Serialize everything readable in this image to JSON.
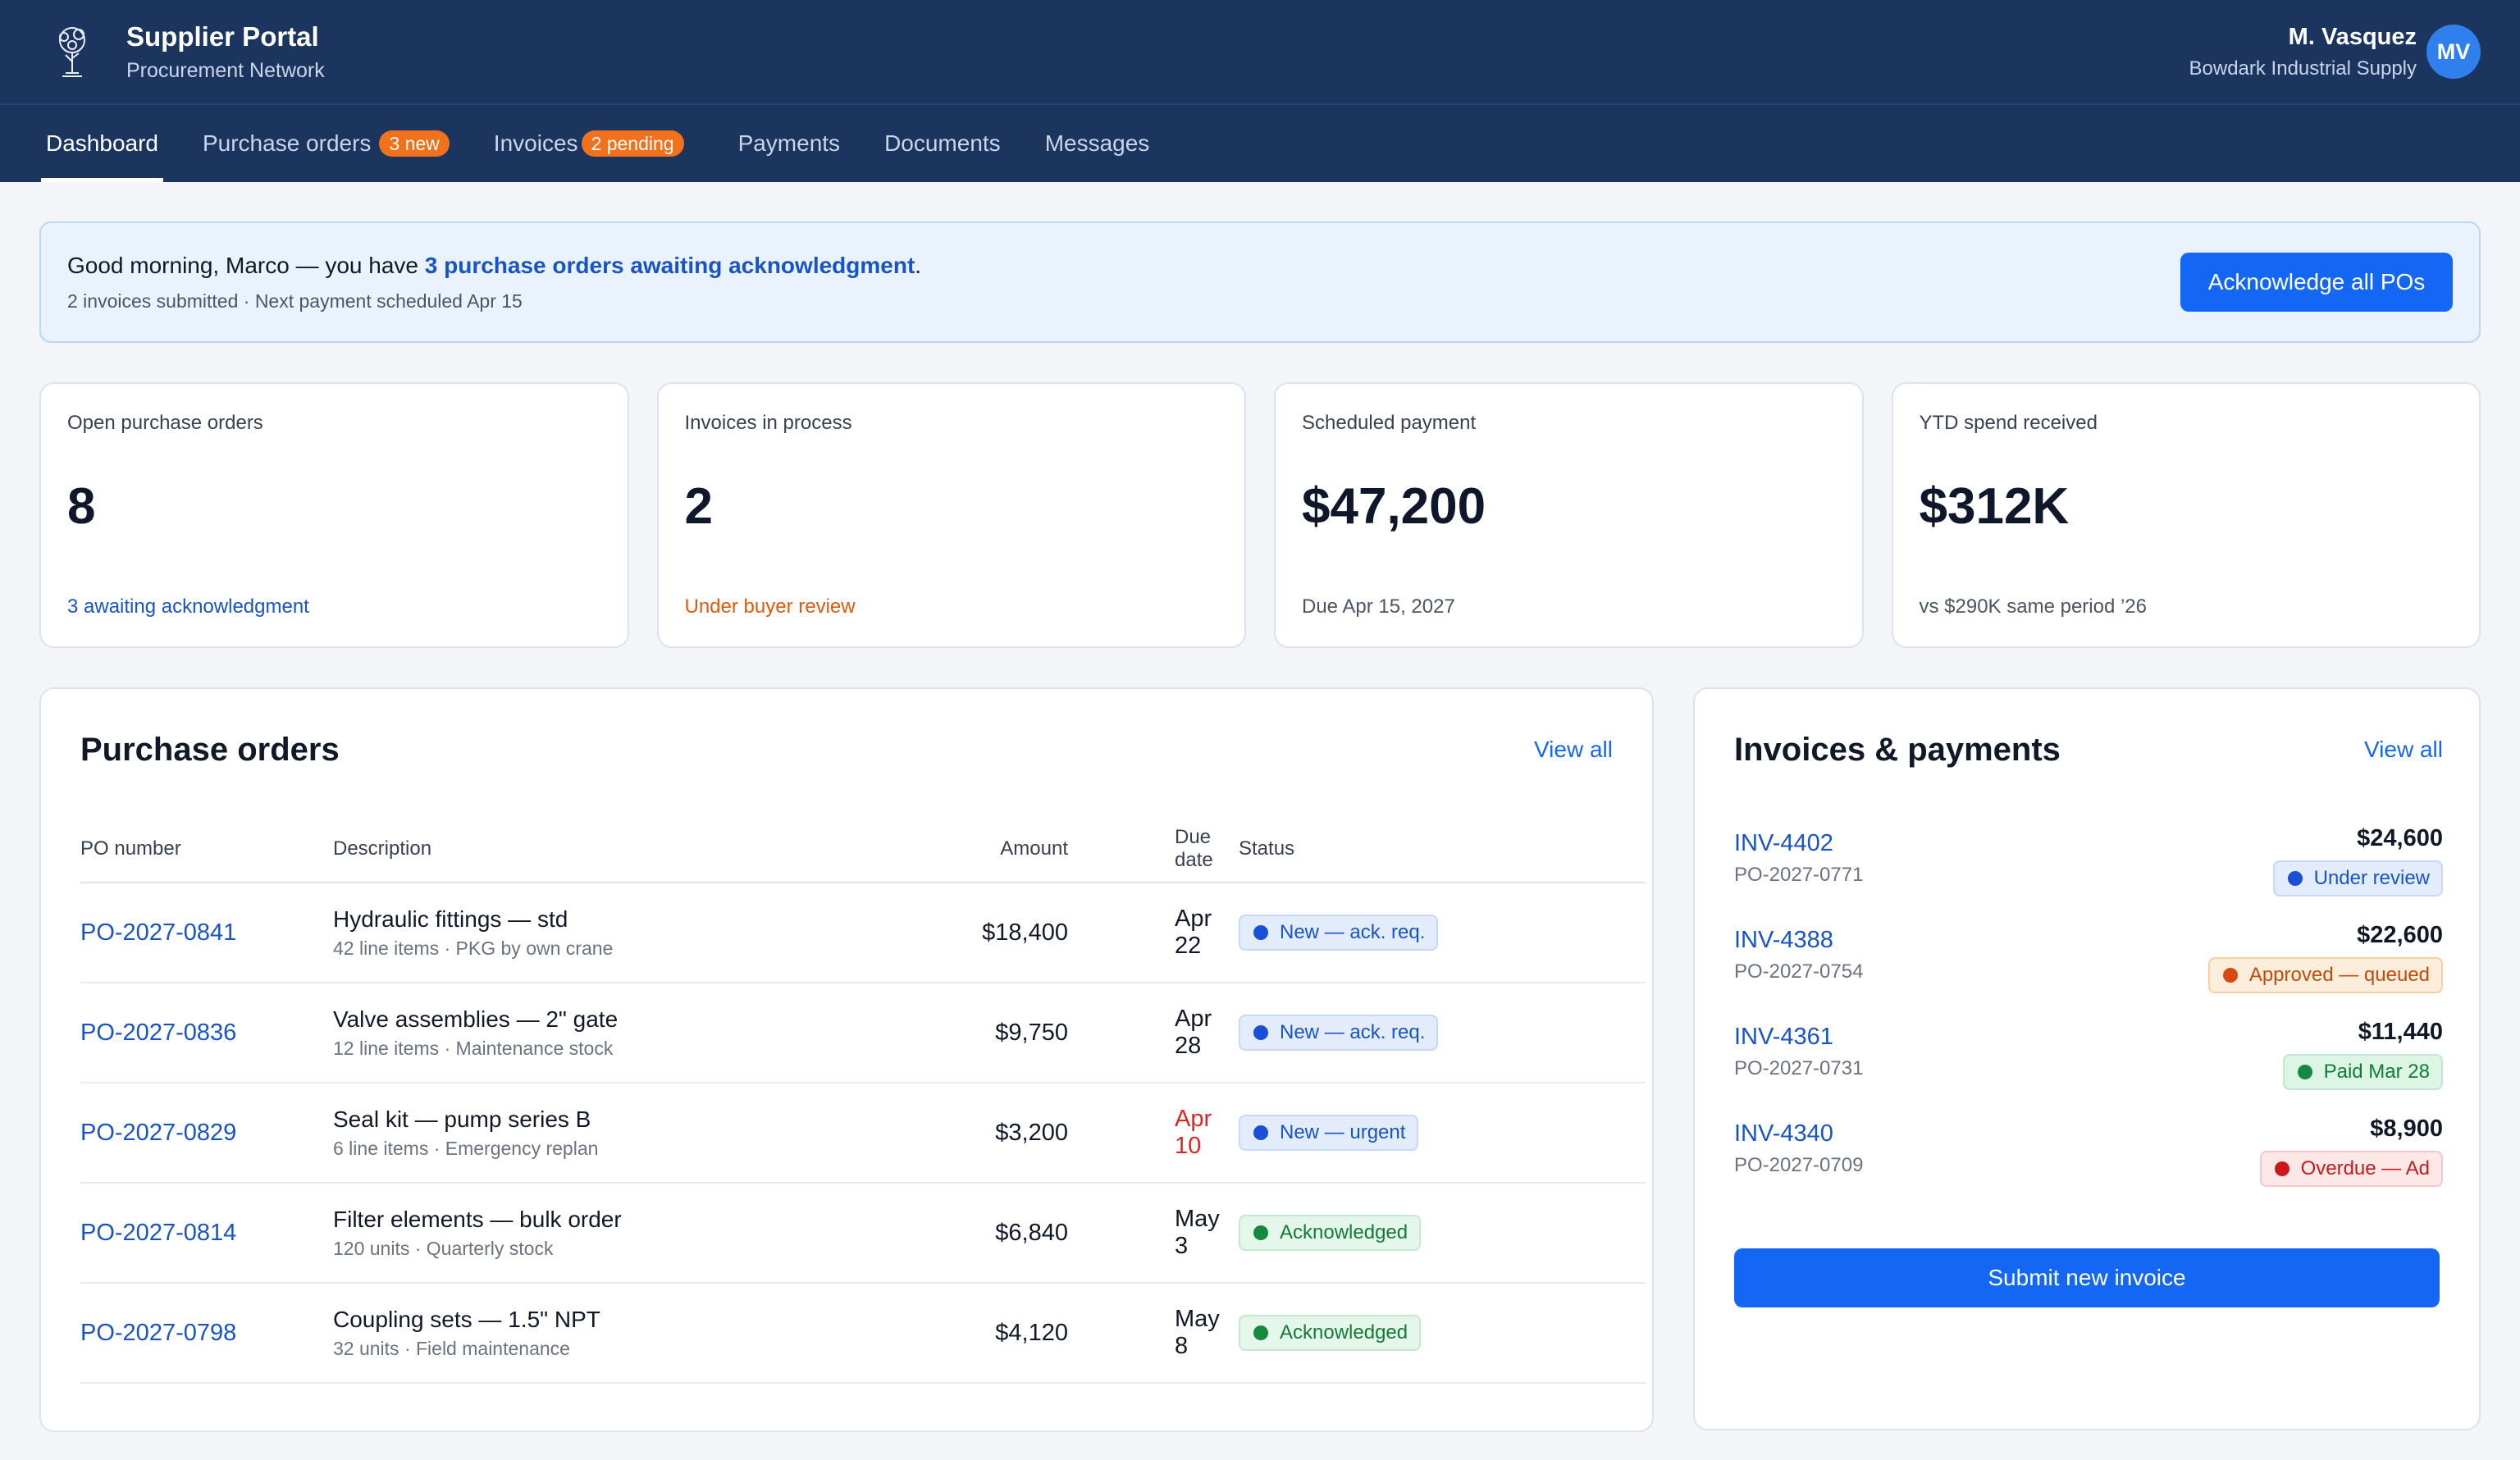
{
  "header": {
    "title": "Supplier Portal",
    "subtitle": "Procurement Network",
    "user_name": "M. Vasquez",
    "user_org": "Bowdark Industrial Supply",
    "avatar_initials": "MV"
  },
  "tabs": [
    {
      "label": "Dashboard",
      "badge": "",
      "active": true
    },
    {
      "label": "Purchase orders",
      "badge": "3 new"
    },
    {
      "label": "Invoices",
      "badge": "2 pending"
    },
    {
      "label": "Payments",
      "badge": ""
    },
    {
      "label": "Documents",
      "badge": ""
    },
    {
      "label": "Messages",
      "badge": ""
    }
  ],
  "banner": {
    "greeting": "Good morning, Marco — you have ",
    "link_text": "3 purchase orders awaiting acknowledgment",
    "after": ".",
    "subtext": "2 invoices submitted · Next payment scheduled Apr 15",
    "button": "Acknowledge all POs"
  },
  "stats": [
    {
      "label": "Open purchase orders",
      "value": "8",
      "note": "3 awaiting acknowledgment"
    },
    {
      "label": "Invoices in process",
      "value": "2",
      "note": "Under buyer review"
    },
    {
      "label": "Scheduled payment",
      "value": "$47,200",
      "note": "Due Apr 15, 2027"
    },
    {
      "label": "YTD spend received",
      "value": "$312K",
      "note": "vs $290K same period ’26"
    }
  ],
  "po": {
    "title": "Purchase orders",
    "view_all": "View all",
    "columns": [
      "PO number",
      "Description",
      "Amount",
      "Due date",
      "Status"
    ],
    "rows": [
      {
        "number": "PO-2027-0841",
        "desc": "Hydraulic fittings — std",
        "sub": "42 line items · PKG by own crane",
        "amount": "$18,400",
        "due": "Apr 22",
        "status": "New — ack. req."
      },
      {
        "number": "PO-2027-0836",
        "desc": "Valve assemblies — 2\" gate",
        "sub": "12 line items · Maintenance stock",
        "amount": "$9,750",
        "due": "Apr 28",
        "status": "New — ack. req."
      },
      {
        "number": "PO-2027-0829",
        "desc": "Seal kit — pump series B",
        "sub": "6 line items · Emergency replan",
        "amount": "$3,200",
        "due": "Apr 10",
        "status": "New — urgent"
      },
      {
        "number": "PO-2027-0814",
        "desc": "Filter elements — bulk order",
        "sub": "120 units · Quarterly stock",
        "amount": "$6,840",
        "due": "May 3",
        "status": "Acknowledged"
      },
      {
        "number": "PO-2027-0798",
        "desc": "Coupling sets — 1.5\" NPT",
        "sub": "32 units · Field maintenance",
        "amount": "$4,120",
        "due": "May 8",
        "status": "Acknowledged"
      }
    ]
  },
  "invoices": {
    "title": "Invoices & payments",
    "view_all": "View all",
    "items": [
      {
        "id": "INV-4402",
        "po": "PO-2027-0771",
        "amount": "$24,600",
        "status": "Under review"
      },
      {
        "id": "INV-4388",
        "po": "PO-2027-0754",
        "amount": "$22,600",
        "status": "Approved — queued"
      },
      {
        "id": "INV-4361",
        "po": "PO-2027-0731",
        "amount": "$11,440",
        "status": "Paid Mar 28"
      },
      {
        "id": "INV-4340",
        "po": "PO-2027-0709",
        "amount": "$8,900",
        "status": "Overdue — Ad"
      }
    ],
    "button": "Submit new invoice"
  },
  "colors": {
    "nav_bg": "#1c355e",
    "accent": "#1467f5",
    "link": "#1853c7",
    "badge_orange": "#f2711c",
    "overdue_red": "#dc2626"
  }
}
